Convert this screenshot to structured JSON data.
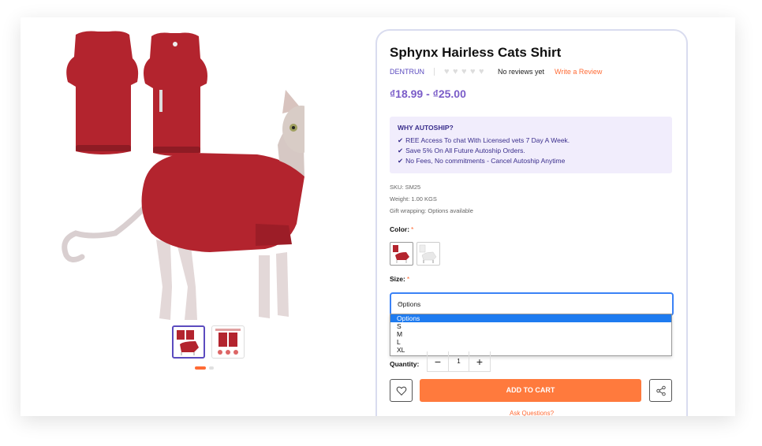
{
  "product": {
    "title": "Sphynx Hairless Cats Shirt",
    "brand": "DENTRUN",
    "reviews_text": "No reviews yet",
    "write_review": "Write a Review",
    "price": "₫18.99 - ₫25.00"
  },
  "autoship": {
    "heading": "WHY AUTOSHIP?",
    "items": [
      "REE Access To chat With Licensed vets 7 Day A Week.",
      "Save 5% On All Future Autoship Orders.",
      "No Fees, No commitments - Cancel Autoship Anytime"
    ]
  },
  "info": {
    "sku": "SKU: SM25",
    "weight": "Weight: 1.00 KGS",
    "gift": "Gift wrapping: Options available"
  },
  "color": {
    "label": "Color:",
    "required": "*"
  },
  "size": {
    "label": "Size:",
    "required": "*",
    "selected": "Options",
    "options": [
      "Options",
      "S",
      "M",
      "L",
      "XL"
    ]
  },
  "quantity": {
    "label": "Quantity:",
    "value": "1",
    "minus": "−",
    "plus": "+"
  },
  "actions": {
    "add_to_cart": "ADD TO CART",
    "ask": "Ask Questions?"
  },
  "colors": {
    "accent": "#ff7a3d",
    "brand": "#5b4bbf",
    "shirt": "#b3242e"
  }
}
